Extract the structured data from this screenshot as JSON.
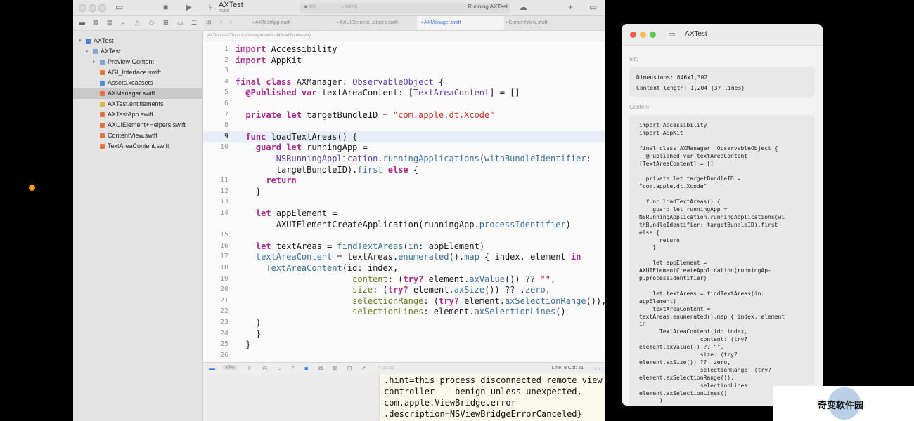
{
  "xcode": {
    "title": "AXTest",
    "subtitle": "main",
    "run_status": "Running AXTest",
    "navigator": {
      "items": [
        {
          "label": "AXTest",
          "level": 0,
          "expanded": true,
          "kind": "project"
        },
        {
          "label": "AXTest",
          "level": 1,
          "expanded": true,
          "kind": "folder"
        },
        {
          "label": "Preview Content",
          "level": 2,
          "expanded": false,
          "kind": "folder"
        },
        {
          "label": "AGI_Interface.swift",
          "level": 2,
          "kind": "file"
        },
        {
          "label": "Assets.xcassets",
          "level": 2,
          "kind": "asset"
        },
        {
          "label": "AXManager.swift",
          "level": 2,
          "kind": "file",
          "selected": true
        },
        {
          "label": "AXTest.entitlements",
          "level": 2,
          "kind": "entitlements"
        },
        {
          "label": "AXTestApp.swift",
          "level": 2,
          "kind": "file"
        },
        {
          "label": "AXUIElement+Helpers.swift",
          "level": 2,
          "kind": "file"
        },
        {
          "label": "ContentView.swift",
          "level": 2,
          "kind": "file"
        },
        {
          "label": "TextAreaContent.swift",
          "level": 2,
          "kind": "file"
        }
      ]
    },
    "tabs": [
      {
        "label": "AXTestApp.swift",
        "active": false
      },
      {
        "label": "AXUIElement...elpers.swift",
        "active": false
      },
      {
        "label": "AXManager.swift",
        "active": true
      },
      {
        "label": "ContentView.swift",
        "active": false
      }
    ],
    "jumpbar": "AXTest  ›  AXTest  ›  AXManager.swift  ›  M  loadTextAreas()",
    "editor": {
      "current_line": 9,
      "lines": [
        {
          "n": "1",
          "html": "<span class=\"kw\">import</span> Accessibility"
        },
        {
          "n": "2",
          "html": "<span class=\"kw\">import</span> AppKit"
        },
        {
          "n": "3",
          "html": ""
        },
        {
          "n": "4",
          "html": "<span class=\"kw\">final class</span> AXManager: <span class=\"ty\">ObservableObject</span> {"
        },
        {
          "n": "5",
          "html": "  <span class=\"kw\">@Published var</span> textAreaContent: [<span class=\"ty\">TextAreaContent</span>] = []"
        },
        {
          "n": "6",
          "html": ""
        },
        {
          "n": "7",
          "html": "  <span class=\"kw\">private let</span> targetBundleID = <span class=\"st\">\"com.apple.dt.Xcode\"</span>"
        },
        {
          "n": "8",
          "html": ""
        },
        {
          "n": "9",
          "html": "  <span class=\"kw\">func</span> loadTextAreas() {"
        },
        {
          "n": "10",
          "html": "    <span class=\"kw\">guard let</span> runningApp ="
        },
        {
          "n": "",
          "html": "        <span class=\"ty\">NSRunningApplication</span>.<span class=\"fn\">runningApplications</span>(<span class=\"fn\">withBundleIdentifier</span>:"
        },
        {
          "n": "",
          "html": "        targetBundleID).<span class=\"fn\">first</span> <span class=\"kw\">else</span> {"
        },
        {
          "n": "11",
          "html": "      <span class=\"kw\">return</span>"
        },
        {
          "n": "12",
          "html": "    }"
        },
        {
          "n": "13",
          "html": ""
        },
        {
          "n": "14",
          "html": "    <span class=\"kw\">let</span> appElement ="
        },
        {
          "n": "",
          "html": "        AXUIElementCreateApplication(runningApp.<span class=\"fn\">processIdentifier</span>)"
        },
        {
          "n": "15",
          "html": ""
        },
        {
          "n": "16",
          "html": "    <span class=\"kw\">let</span> textAreas = <span class=\"fn\">findTextAreas</span>(<span class=\"fn\">in</span>: appElement)"
        },
        {
          "n": "17",
          "html": "    <span class=\"fn\">textAreaContent</span> = textAreas.<span class=\"fn\">enumerated</span>().<span class=\"fn\">map</span> { index, element <span class=\"kw\">in</span>"
        },
        {
          "n": "18",
          "html": "      <span class=\"fn\">TextAreaContent</span>(id: index,"
        },
        {
          "n": "19",
          "html": "                       <span class=\"pm\">content</span>: (<span class=\"kw\">try?</span> element.<span class=\"fn\">axValue</span>()) ?? <span class=\"st\">\"\"</span>,"
        },
        {
          "n": "20",
          "html": "                       <span class=\"pm\">size</span>: (<span class=\"kw\">try?</span> element.<span class=\"fn\">axSize</span>()) ?? .<span class=\"fn\">zero</span>,"
        },
        {
          "n": "21",
          "html": "                       <span class=\"pm\">selectionRange</span>: (<span class=\"kw\">try?</span> element.<span class=\"fn\">axSelectionRange</span>()),"
        },
        {
          "n": "22",
          "html": "                       <span class=\"pm\">selectionLines</span>: element.<span class=\"fn\">axSelectionLines</span>()"
        },
        {
          "n": "23",
          "html": "    )"
        },
        {
          "n": "24",
          "html": "    }"
        },
        {
          "n": "25",
          "html": "  }"
        },
        {
          "n": "26",
          "html": ""
        }
      ]
    },
    "debug": {
      "scope": "Vim",
      "line_col": "Line: 9  Col: 21"
    },
    "console": [
      ".hint=this process disconnected remote view",
      "controller -- benign unless unexpected,",
      "com.apple.ViewBridge.error",
      ".description=NSViewBridgeErrorCanceled}"
    ]
  },
  "axtest": {
    "title": "AXTest",
    "info_label": "Info",
    "dimensions": "Dimensions: 846x1,302",
    "content_length": "Content length: 1,204 (37 lines)",
    "content_label": "Content",
    "content_lines": [
      "import Accessibility",
      "import AppKit",
      "",
      "final class AXManager: ObservableObject {",
      "  @Published var textAreaContent:",
      "[TextAreaContent] = []",
      "",
      "  private let targetBundleID =",
      "\"com.apple.dt.Xcode\"",
      "",
      "  func loadTextAreas() {",
      "    guard let runningApp =",
      "NSRunningApplication.runningApplications(wi",
      "thBundleIdentifier: targetBundleID).first",
      "else {",
      "      return",
      "    }",
      "",
      "    let appElement =",
      "AXUIElementCreateApplication(runningAp-",
      "p.processIdentifier)",
      "",
      "    let textAreas = findTextAreas(in:",
      "appElement)",
      "    textAreaContent =",
      "textAreas.enumerated().map { index, element",
      "in",
      "      TextAreaContent(id: index,",
      "                  content: (try?",
      "element.axValue()) ?? \"\",",
      "                  size: (try?",
      "element.axSize()) ?? .zero,",
      "                  selectionRange: (try?",
      "element.axSelectionRange()),",
      "                  selectionLines:",
      "element.axSelectionLines()",
      "      )"
    ]
  },
  "watermark": "奇变软件园",
  "colors": {
    "keyword": "#a82a8c",
    "type": "#5b3fa6",
    "function": "#3a6fa0",
    "string": "#c3342a",
    "accent": "#3b7ae8",
    "indicator": "#f6a21a"
  }
}
